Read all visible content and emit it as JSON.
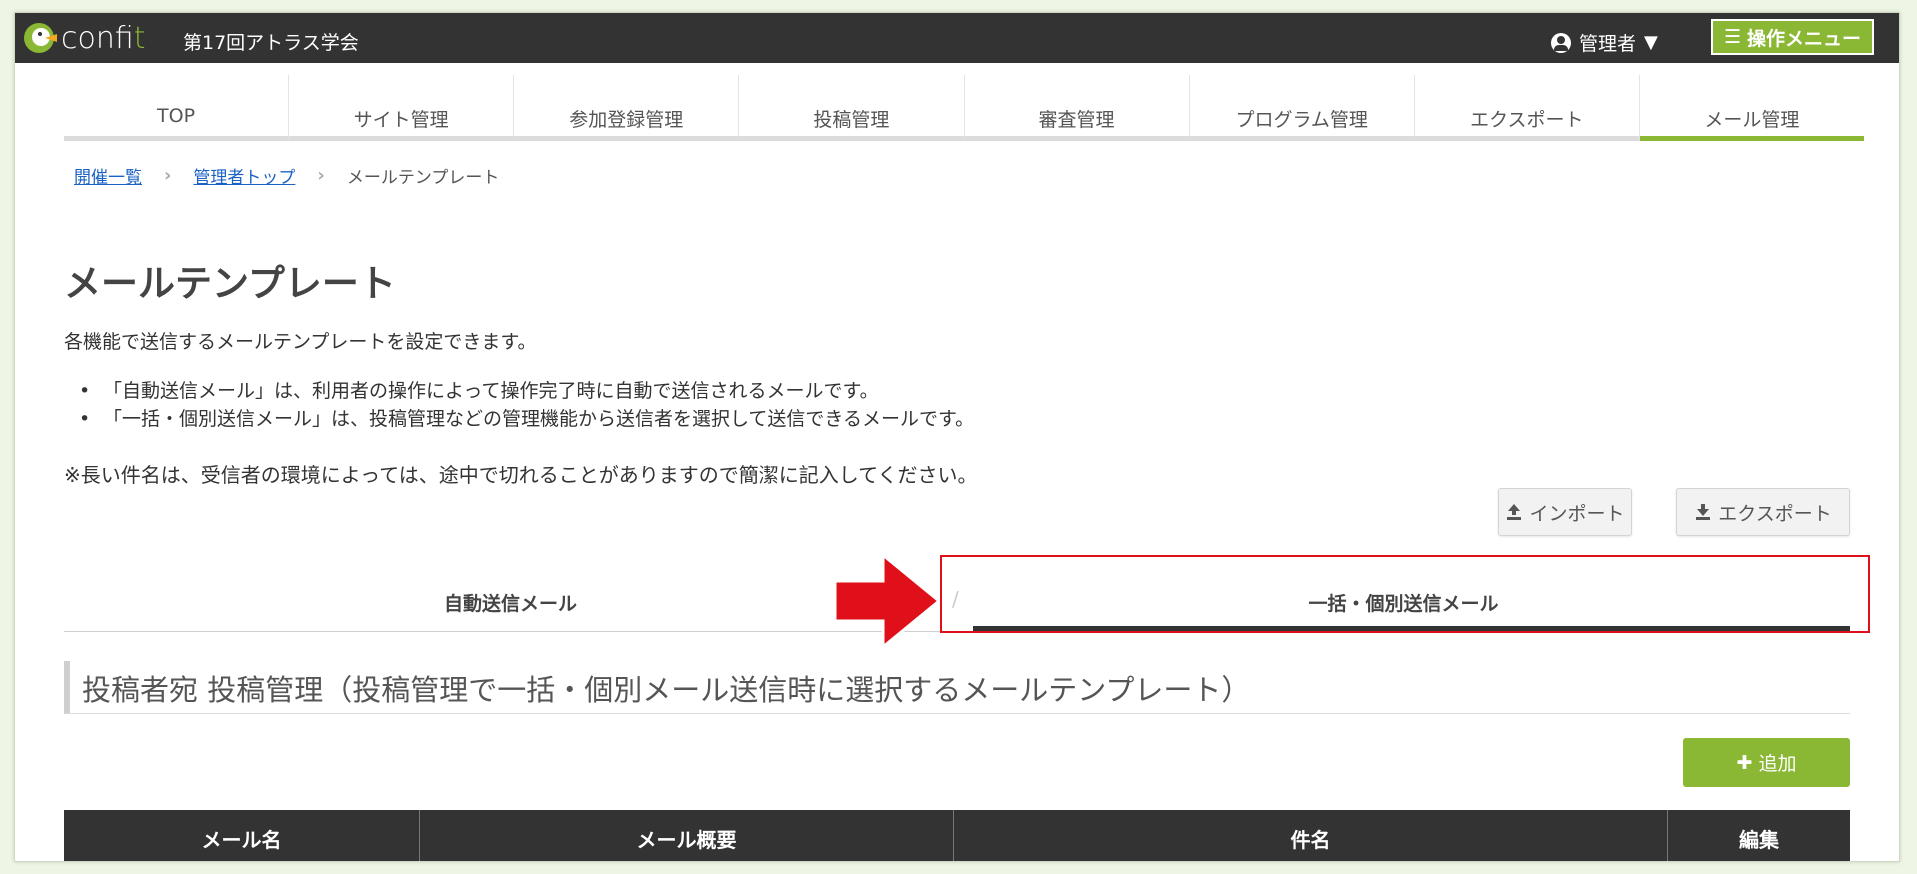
{
  "header": {
    "logo_text_main": "conf",
    "logo_text_accent": "it",
    "event_title": "第17回アトラス学会",
    "user_label": "管理者",
    "user_caret": "▼",
    "operation_menu_label": "操作メニュー",
    "operation_menu_icon": "☰"
  },
  "nav": {
    "items": [
      {
        "label": "TOP"
      },
      {
        "label": "サイト管理"
      },
      {
        "label": "参加登録管理"
      },
      {
        "label": "投稿管理"
      },
      {
        "label": "審査管理"
      },
      {
        "label": "プログラム管理"
      },
      {
        "label": "エクスポート"
      },
      {
        "label": "メール管理"
      }
    ],
    "active_index": 7
  },
  "breadcrumb": {
    "item1": "開催一覧",
    "item2": "管理者トップ",
    "current": "メールテンプレート",
    "separator": "›"
  },
  "page": {
    "title": "メールテンプレート",
    "description": "各機能で送信するメールテンプレートを設定できます。",
    "bullets": [
      "「自動送信メール」は、利用者の操作によって操作完了時に自動で送信されるメールです。",
      "「一括・個別送信メール」は、投稿管理などの管理機能から送信者を選択して送信できるメールです。"
    ],
    "note": "※長い件名は、受信者の環境によっては、途中で切れることがありますので簡潔に記入してください。"
  },
  "actions": {
    "import_label": "インポート",
    "export_label": "エクスポート",
    "add_label": "追加",
    "add_icon": "✚"
  },
  "tabs": {
    "auto": "自動送信メール",
    "bulk": "一括・個別送信メール",
    "divider": "/"
  },
  "section": {
    "heading": "投稿者宛 投稿管理（投稿管理で一括・個別メール送信時に選択するメールテンプレート）"
  },
  "table": {
    "headers": [
      "メール名",
      "メール概要",
      "件名",
      "編集"
    ]
  },
  "colors": {
    "accent": "#8ab734",
    "header_bg": "#333333",
    "highlight": "#e0101a"
  }
}
